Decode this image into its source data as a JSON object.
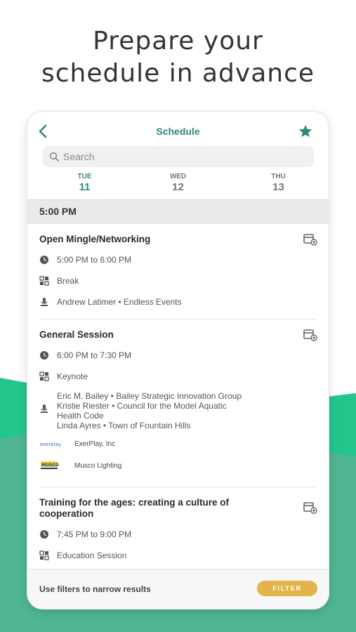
{
  "headline": {
    "line1": "Prepare your",
    "line2": "schedule in advance"
  },
  "colors": {
    "accent": "#2e8b7a",
    "wave_back": "#22c68b",
    "wave_front": "#4fb592",
    "filter_button": "#e2b44a"
  },
  "appbar": {
    "title": "Schedule",
    "back_icon": "chevron-left-icon",
    "favorite_icon": "star-icon"
  },
  "search": {
    "placeholder": "Search"
  },
  "tabs": [
    {
      "dow": "TUE",
      "day": "11",
      "active": true
    },
    {
      "dow": "WED",
      "day": "12",
      "active": false
    },
    {
      "dow": "THU",
      "day": "13",
      "active": false
    }
  ],
  "time_band": {
    "label": "5:00 PM"
  },
  "sessions": [
    {
      "title": "Open Mingle/Networking",
      "time": "5:00 PM to 6:00 PM",
      "type": "Break",
      "speakers": [
        "Andrew Latimer • Endless Events"
      ]
    },
    {
      "title": "General Session",
      "time": "6:00 PM to 7:30 PM",
      "type": "Keynote",
      "speakers": [
        "Eric M. Bailey • Bailey Strategic Innovation Group",
        "Kristie Riester • Council for the Model Aquatic",
        "Health Code",
        "Linda Ayres • Town of Fountain Hills"
      ],
      "sponsors": [
        {
          "name": "ExerPlay, Inc",
          "logo_text": "exerplay"
        },
        {
          "name": "Musco Lighting",
          "logo_text": "MUSCO"
        }
      ]
    },
    {
      "title_line1": "Training for the ages: creating a culture of",
      "title_line2": "cooperation",
      "time": "7:45 PM to 9:00 PM",
      "type": "Education Session"
    }
  ],
  "footer": {
    "text": "Use filters to narrow results",
    "filter_label": "FILTER"
  }
}
